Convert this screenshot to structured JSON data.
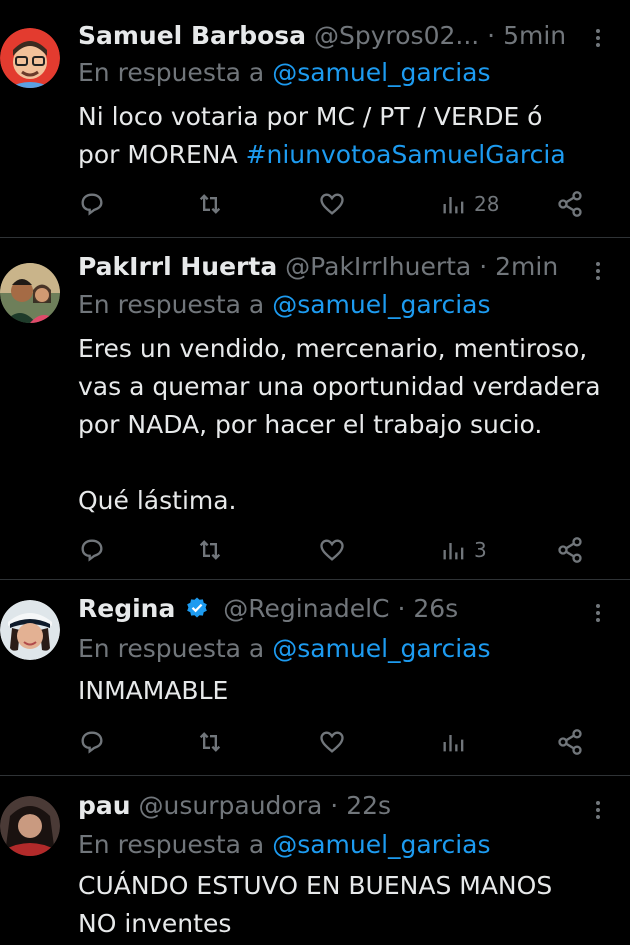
{
  "tweets": [
    {
      "name": "Samuel Barbosa",
      "handle": "@Spyros02...",
      "dot": "·",
      "time": "5min",
      "reply_prefix": "En respuesta a",
      "reply_to": "@samuel_garcias",
      "text": "Ni loco votaria por MC / PT / VERDE ó\npor MORENA ",
      "hashtag": "#niunvotoaSamuelGarcia",
      "views": "28",
      "verified": false
    },
    {
      "name": "PakIrrl Huerta",
      "handle": "@PakIrrIhuerta",
      "dot": "·",
      "time": "2min",
      "reply_prefix": "En respuesta a",
      "reply_to": "@samuel_garcias",
      "text": "Eres un vendido, mercenario, mentiroso,\nvas a quemar una oportunidad verdadera\npor NADA, por hacer el trabajo sucio.\n\nQué lástima.",
      "views": "3",
      "verified": false
    },
    {
      "name": "Regina",
      "handle": "@ReginadelC",
      "dot": "·",
      "time": "26s",
      "reply_prefix": "En respuesta a",
      "reply_to": "@samuel_garcias",
      "text": "INMAMABLE",
      "views": "",
      "verified": true
    },
    {
      "name": "pau",
      "handle": "@usurpaudora",
      "dot": "·",
      "time": "22s",
      "reply_prefix": "En respuesta a",
      "reply_to": "@samuel_garcias",
      "text": "CUÁNDO ESTUVO EN BUENAS MANOS\nNO inventes",
      "verified": false
    }
  ],
  "icons": [
    "reply-icon",
    "retweet-icon",
    "like-icon",
    "views-icon",
    "share-icon",
    "more-icon",
    "verified-badge-icon"
  ],
  "colors": {
    "background": "#000000",
    "text": "#e7e9ea",
    "muted": "#71767b",
    "link": "#1d9bf0",
    "divider": "#2f3336"
  }
}
